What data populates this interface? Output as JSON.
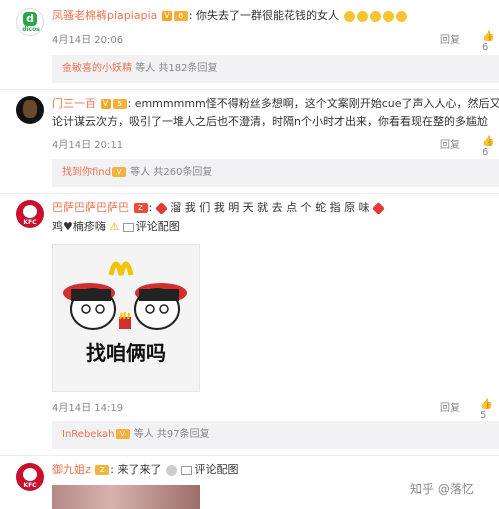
{
  "comments": [
    {
      "name": "凤骚老棉裤piapiapia",
      "text": "你失去了一群很能花钱的女人",
      "time": "4月14日 20:06",
      "reply_btn": "回复",
      "reply_thread": {
        "who": "金敏喜的小妖精",
        "rest": "等人 共182条回复"
      }
    },
    {
      "name": "门三一百",
      "text1": "emmmmmm怪不得粉丝多想啊，这个文案刚开始cue了声入人心，然后又全国",
      "text2": "论计谋云次方，吸引了一堆人之后也不澄清，时隔n个小时才出来，你看看现在整的多尴尬",
      "time": "4月14日 20:11",
      "reply_btn": "回复",
      "reply_thread": {
        "who": "找到你find",
        "rest": "等人 共260条回复"
      }
    },
    {
      "name": "巴萨巴萨巴萨巴",
      "text1": "溜 我 们 我 明 天 就 去 点 个 蛇 指 原 味",
      "text2": "鸡♥楠疹嗨",
      "media": "评论配图",
      "meme_caption": "找咱俩吗",
      "time": "4月14日 14:19",
      "reply_btn": "回复",
      "reply_thread": {
        "who": "InRebekah",
        "rest": "等人 共97条回复"
      }
    },
    {
      "name": "御九姐z",
      "text": "来了来了",
      "media": "评论配图"
    }
  ],
  "watermark": "知乎 @落忆",
  "colors": {
    "accent": "#eb7350",
    "reply_bg": "#f2f2f5"
  }
}
